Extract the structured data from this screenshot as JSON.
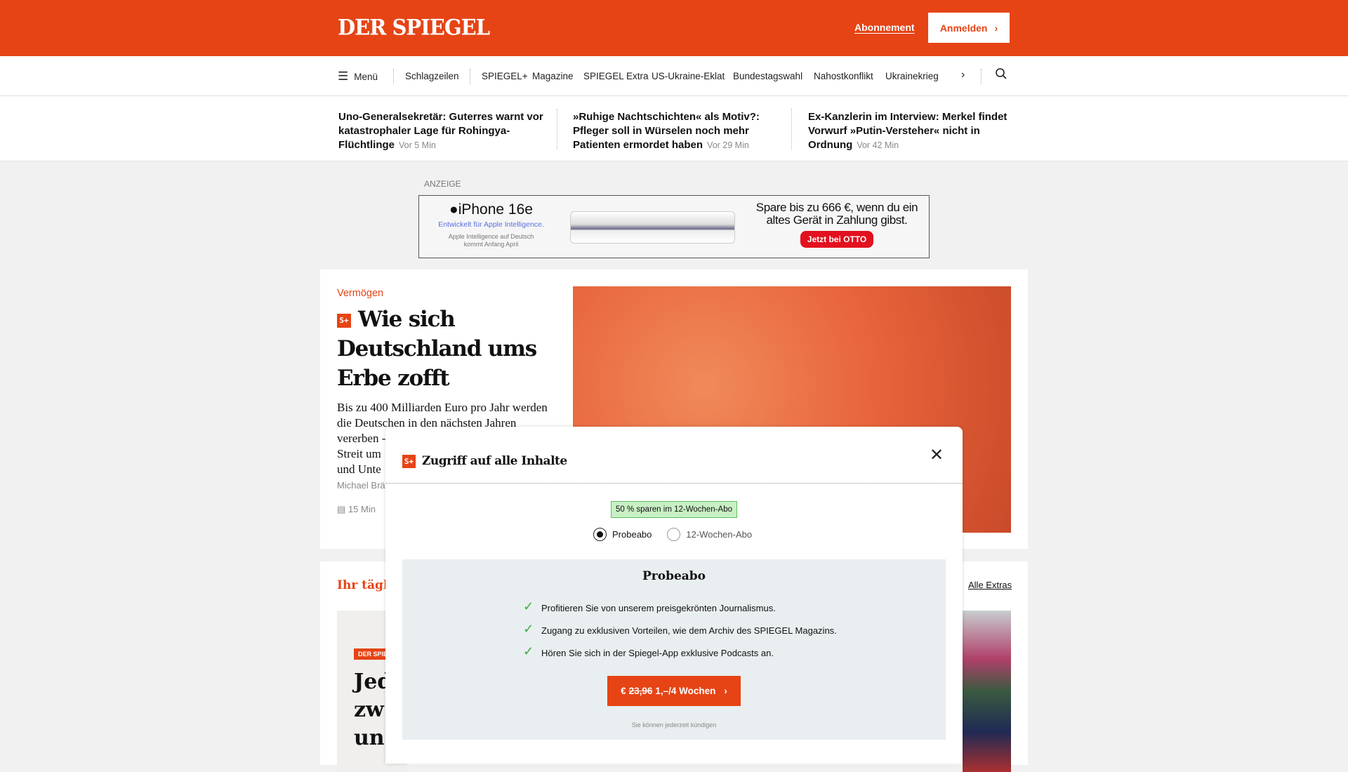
{
  "header": {
    "logo": "DER SPIEGEL",
    "subscription_link": "Abonnement",
    "login_button": "Anmelden"
  },
  "nav": {
    "menu": "Menü",
    "items": [
      "Schlagzeilen",
      "SPIEGEL+",
      "Magazine",
      "SPIEGEL Extra",
      "US-Ukraine-Eklat",
      "Bundestagswahl",
      "Nahostkonflikt",
      "Ukrainekrieg"
    ]
  },
  "headlines": [
    {
      "title": "Uno-Generalsekretär: Guterres warnt vor katastrophaler Lage für Rohingya-Flüchtlinge",
      "time": "Vor 5 Min"
    },
    {
      "title": "»Ruhige Nachtschichten« als Motiv?: Pfleger soll in Würselen noch mehr Patienten ermordet haben",
      "time": "Vor 29 Min"
    },
    {
      "title": "Ex-Kanzlerin im Interview: Merkel findet Vorwurf »Putin-Versteher« nicht in Ordnung",
      "time": "Vor 42 Min"
    }
  ],
  "ad": {
    "label": "ANZEIGE",
    "product": "iPhone 16e",
    "tagline": "Entwickelt für Apple Intelligence.",
    "note": "Apple Intelligence auf Deutsch kommt Anfang April",
    "offer": "Spare bis zu 666 €, wenn du ein altes Gerät in Zahlung gibst.",
    "cta": "Jetzt bei OTTO"
  },
  "article": {
    "kicker": "Vermögen",
    "badge": "S+",
    "title": "Wie sich Deutschland ums Erbe zofft",
    "teaser_lines": [
      "Bis zu 400 Milliarden Euro pro Jahr werden",
      "die Deutschen in den nächsten Jahren",
      "vererben -",
      "Streit um",
      "und Unte"
    ],
    "author": "Michael Brä",
    "reading_time": "15 Min"
  },
  "section2": {
    "title": "Ihr täglic",
    "all_link": "Alle Extras",
    "badge": "DER SPIE",
    "headline_lines": [
      "Jed",
      "zw",
      "un"
    ]
  },
  "modal": {
    "badge": "S+",
    "title": "Zugriff auf alle Inhalte",
    "promo": "50 % sparen im 12-Wochen-Abo",
    "options": [
      {
        "label": "Probeabo",
        "selected": true
      },
      {
        "label": "12-Wochen-Abo",
        "selected": false
      }
    ],
    "panel_title": "Probeabo",
    "benefits": [
      "Profitieren Sie von unserem preisgekrönten Journalismus.",
      "Zugang zu exklusiven Vorteilen, wie dem Archiv des SPIEGEL Magazins.",
      "Hören Sie sich in der Spiegel-App exklusive Podcasts an."
    ],
    "cta_currency": "€",
    "cta_old_price": "23,96",
    "cta_price": "1,–/4 Wochen",
    "footnote": "Sie können jederzeit kündigen"
  }
}
